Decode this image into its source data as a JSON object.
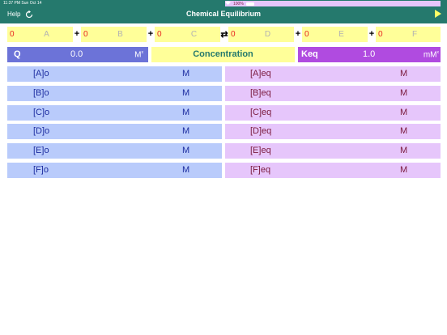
{
  "status": {
    "time": "11:37 PM  Sun Oct 14",
    "battery": "100%"
  },
  "nav": {
    "help": "Help",
    "title": "Chemical Equilibrium"
  },
  "reaction": {
    "reactants": [
      {
        "coef": "0",
        "species": "A"
      },
      {
        "coef": "0",
        "species": "B"
      },
      {
        "coef": "0",
        "species": "C"
      }
    ],
    "products": [
      {
        "coef": "0",
        "species": "D"
      },
      {
        "coef": "0",
        "species": "E"
      },
      {
        "coef": "0",
        "species": "F"
      }
    ],
    "plus": "+",
    "arrow": "⇄"
  },
  "q": {
    "label": "Q",
    "value": "0.0",
    "unit": "M",
    "unit_exp": "x"
  },
  "concentration_label": "Concentration",
  "keq": {
    "label": "Keq",
    "value": "1.0",
    "unit": "mM",
    "unit_exp": "x"
  },
  "initial": [
    {
      "label": "[A]o",
      "unit": "M"
    },
    {
      "label": "[B]o",
      "unit": "M"
    },
    {
      "label": "[C]o",
      "unit": "M"
    },
    {
      "label": "[D]o",
      "unit": "M"
    },
    {
      "label": "[E]o",
      "unit": "M"
    },
    {
      "label": "[F]o",
      "unit": "M"
    }
  ],
  "equilibrium": [
    {
      "label": "[A]eq",
      "unit": "M"
    },
    {
      "label": "[B]eq",
      "unit": "M"
    },
    {
      "label": "[C]eq",
      "unit": "M"
    },
    {
      "label": "[D]eq",
      "unit": "M"
    },
    {
      "label": "[E]eq",
      "unit": "M"
    },
    {
      "label": "[F]eq",
      "unit": "M"
    }
  ]
}
